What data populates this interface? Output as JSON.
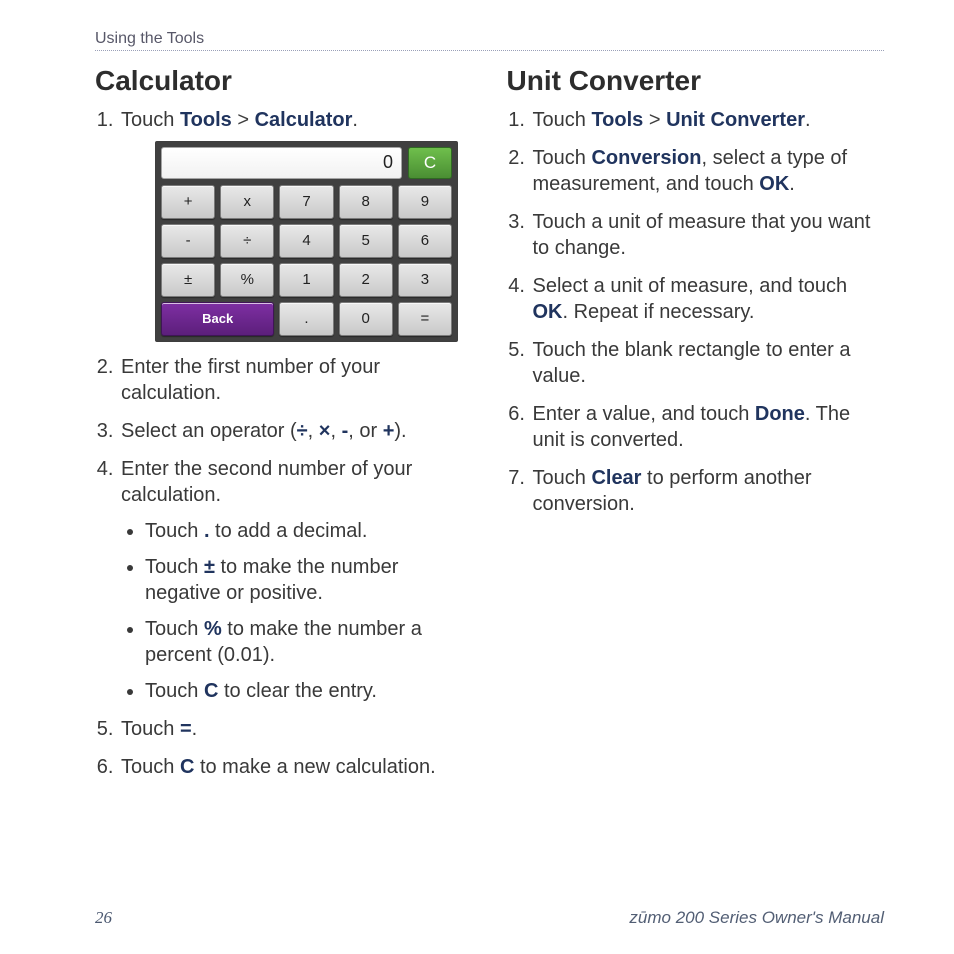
{
  "header": {
    "breadcrumb": "Using the Tools"
  },
  "footer": {
    "page_number": "26",
    "manual": "zūmo 200 Series Owner's Manual"
  },
  "left": {
    "title": "Calculator",
    "step1_a": "Touch ",
    "step1_tools": "Tools",
    "step1_gt": " > ",
    "step1_calc": "Calculator",
    "step1_end": ".",
    "step2": "Enter the first number of your calculation.",
    "step3_a": "Select an operator (",
    "step3_div": "÷",
    "step3_mul": "×",
    "step3_minus": "-",
    "step3_plus": "+",
    "step3_or": ", or ",
    "step3_comma": ", ",
    "step3_end": ").",
    "step4": "Enter the second number of your calculation.",
    "b1_a": "Touch ",
    "b1_dot": ".",
    "b1_b": " to add a decimal.",
    "b2_a": "Touch ",
    "b2_pm": "±",
    "b2_b": " to make the number negative or positive.",
    "b3_a": "Touch ",
    "b3_pct": "%",
    "b3_b": " to make the number a percent (0.01).",
    "b4_a": "Touch ",
    "b4_c": "C",
    "b4_b": " to clear the entry.",
    "step5_a": "Touch ",
    "step5_eq": "=",
    "step5_end": ".",
    "step6_a": "Touch ",
    "step6_c": "C",
    "step6_b": " to make a new calculation."
  },
  "right": {
    "title": "Unit Converter",
    "s1_a": "Touch ",
    "s1_tools": "Tools",
    "s1_gt": " > ",
    "s1_uc": "Unit Converter",
    "s1_end": ".",
    "s2_a": "Touch ",
    "s2_conv": "Conversion",
    "s2_b": ", select a type of measurement, and touch ",
    "s2_ok": "OK",
    "s2_end": ".",
    "s3": "Touch a unit of measure that you want to change.",
    "s4_a": "Select a unit of measure, and touch ",
    "s4_ok": "OK",
    "s4_b": ". Repeat if necessary.",
    "s5": "Touch the blank rectangle to enter a value.",
    "s6_a": "Enter a value, and touch ",
    "s6_done": "Done",
    "s6_b": ". The unit is converted.",
    "s7_a": "Touch ",
    "s7_clear": "Clear",
    "s7_b": " to perform another conversion."
  },
  "calc": {
    "display": "0",
    "clear": "C",
    "keys": {
      "plus": "+",
      "mul": "x",
      "k7": "7",
      "k8": "8",
      "k9": "9",
      "minus": "-",
      "div": "÷",
      "k4": "4",
      "k5": "5",
      "k6": "6",
      "pm": "±",
      "pct": "%",
      "k1": "1",
      "k2": "2",
      "k3": "3",
      "back": "Back",
      "dot": ".",
      "k0": "0",
      "eq": "="
    }
  }
}
